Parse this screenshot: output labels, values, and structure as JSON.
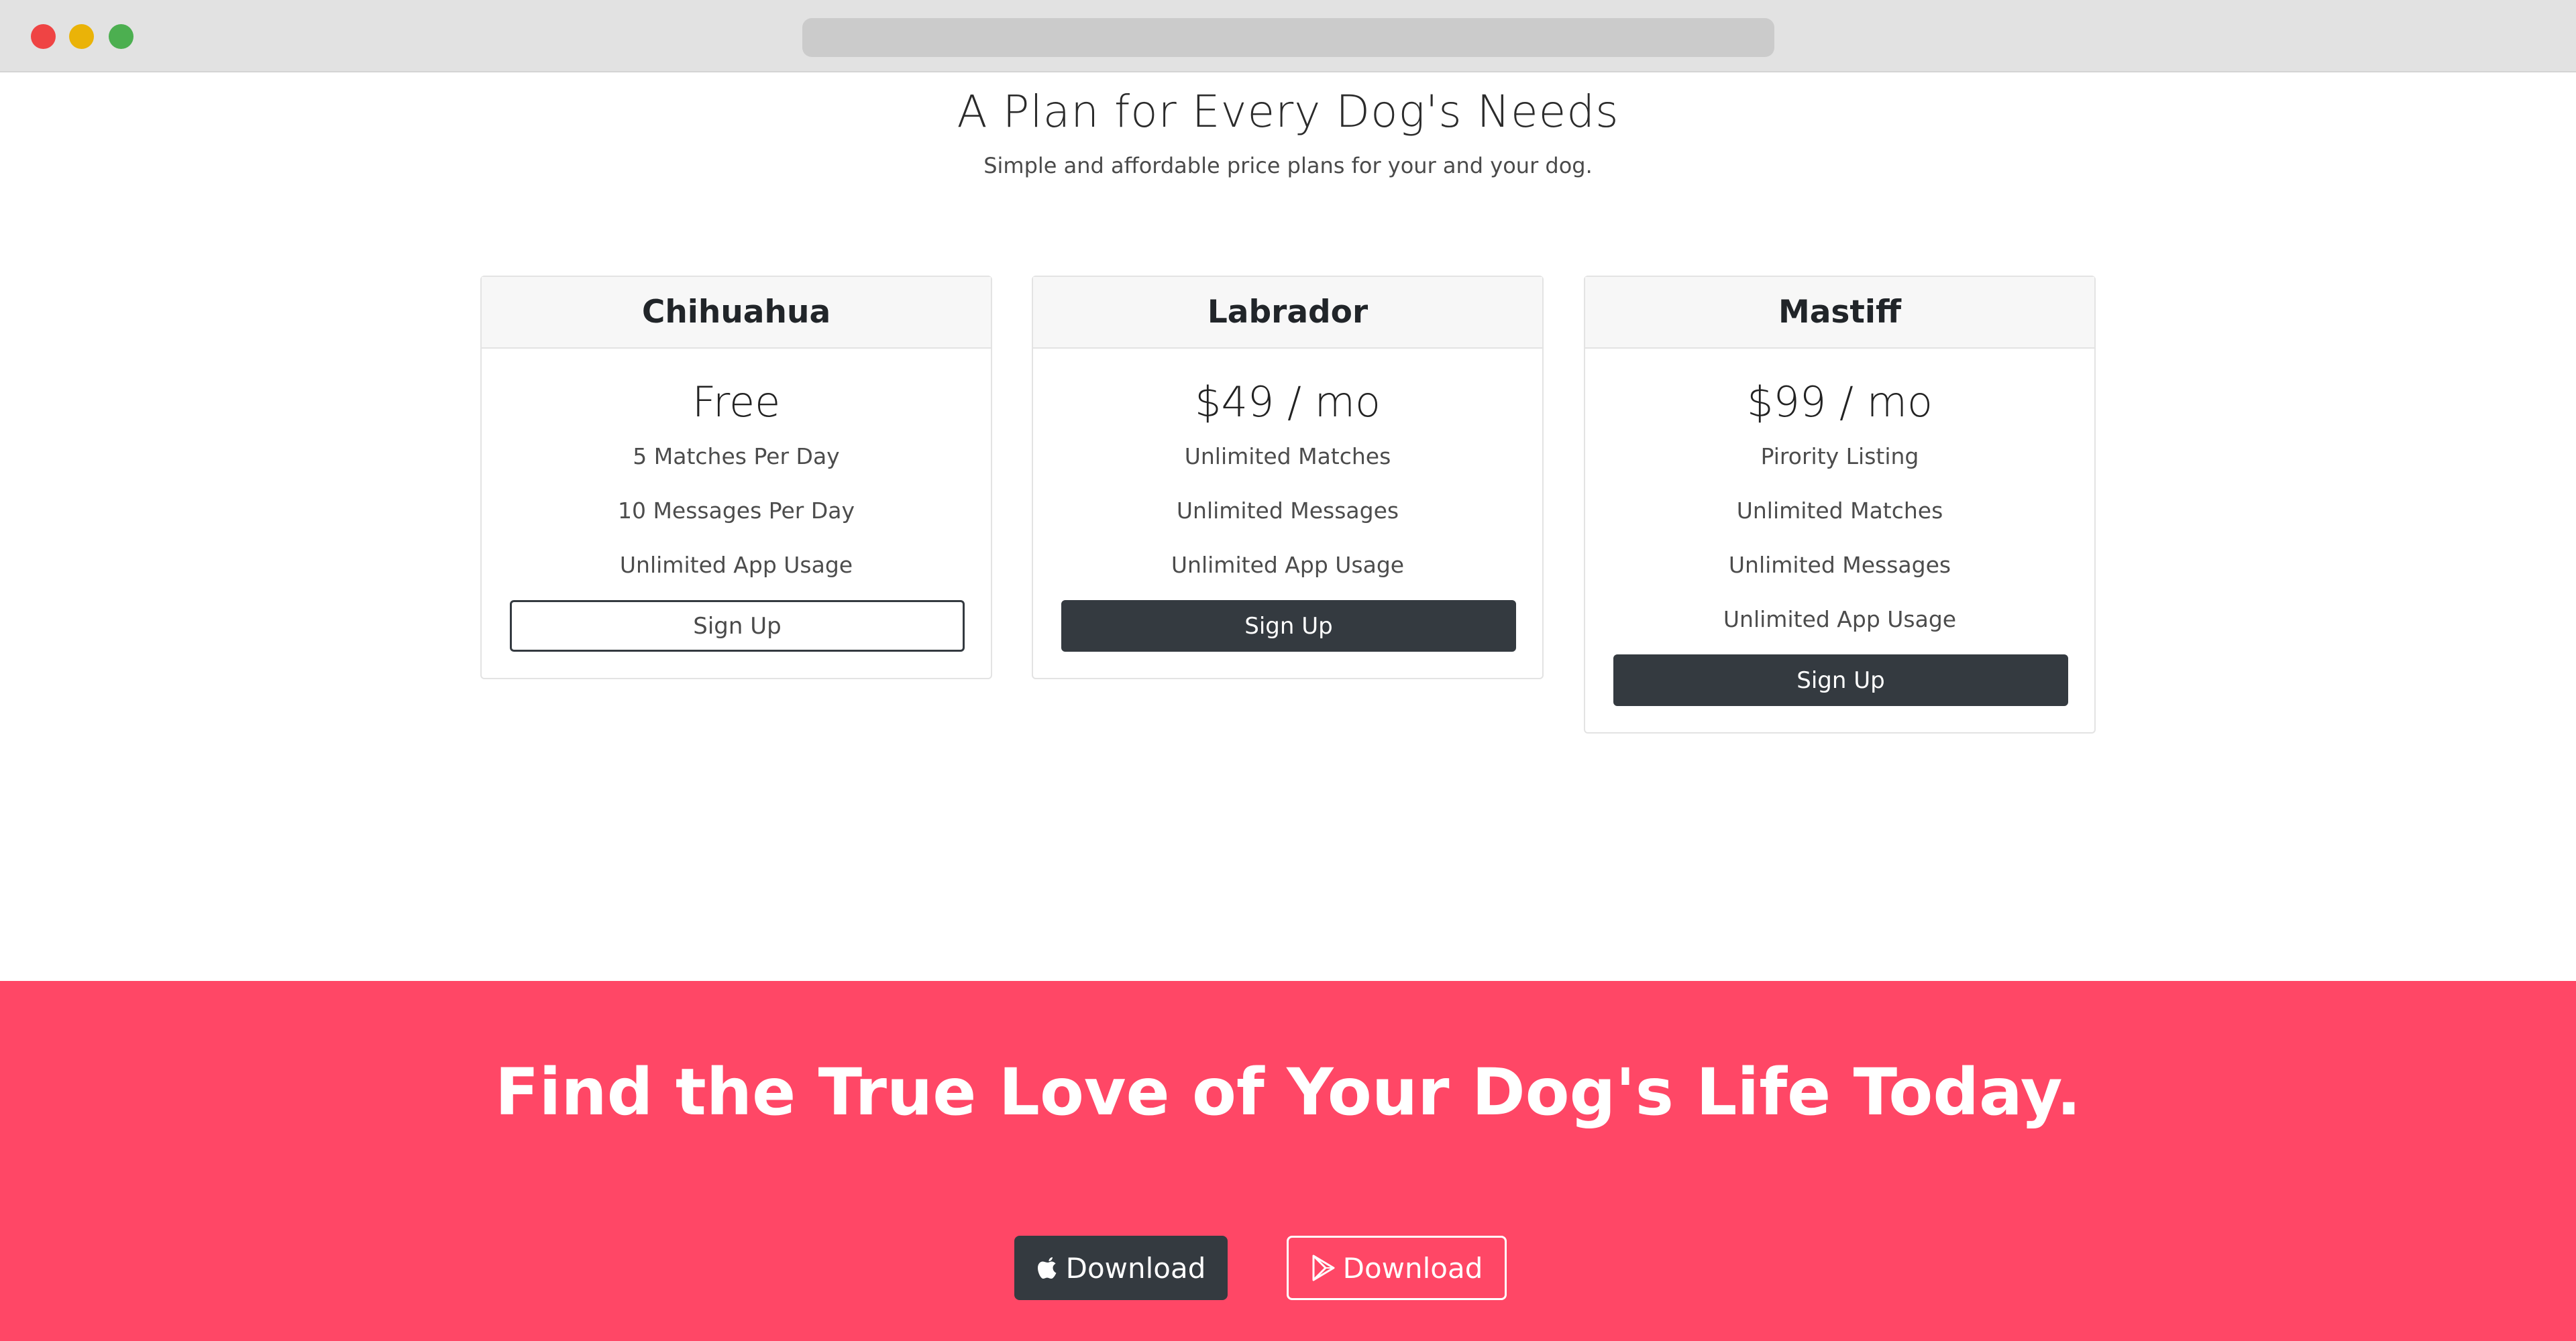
{
  "header": {
    "title": "A Plan for Every Dog's Needs",
    "subtitle": "Simple and affordable price plans for your and your dog."
  },
  "plans": [
    {
      "name": "Chihuahua",
      "price": "Free",
      "features": [
        "5 Matches Per Day",
        "10 Messages Per Day",
        "Unlimited App Usage"
      ],
      "button_label": "Sign Up"
    },
    {
      "name": "Labrador",
      "price": "$49 / mo",
      "features": [
        "Unlimited Matches",
        "Unlimited Messages",
        "Unlimited App Usage"
      ],
      "button_label": "Sign Up"
    },
    {
      "name": "Mastiff",
      "price": "$99 / mo",
      "features": [
        "Pirority Listing",
        "Unlimited Matches",
        "Unlimited Messages",
        "Unlimited App Usage"
      ],
      "button_label": "Sign Up"
    }
  ],
  "cta": {
    "title": "Find the True Love of Your Dog's Life Today.",
    "apple_label": "Download",
    "play_label": "Download",
    "apple_icon": "apple-icon",
    "play_icon": "google-play-icon"
  },
  "colors": {
    "accent": "#ff4766",
    "dark": "#343a40"
  }
}
